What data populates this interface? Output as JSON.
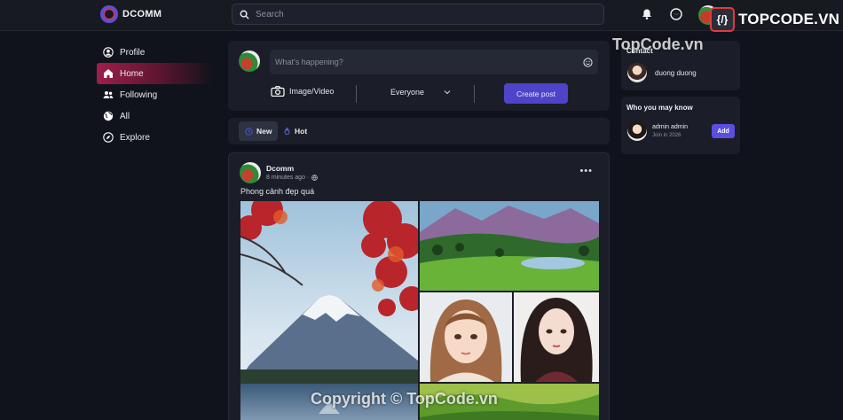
{
  "app": {
    "name": "DCOMM"
  },
  "search": {
    "placeholder": "Search"
  },
  "brand_badge": {
    "mark": "{/}",
    "text": "TOPCODE.VN"
  },
  "nav": {
    "items": [
      {
        "label": "Profile",
        "icon": "user-circle-icon"
      },
      {
        "label": "Home",
        "icon": "home-icon",
        "active": true
      },
      {
        "label": "Following",
        "icon": "users-icon"
      },
      {
        "label": "All",
        "icon": "globe-icon"
      },
      {
        "label": "Explore",
        "icon": "compass-icon"
      }
    ]
  },
  "composer": {
    "placeholder": "What's happening?",
    "media_label": "Image/Video",
    "audience": "Everyone",
    "create_label": "Create post"
  },
  "feed_tabs": [
    {
      "label": "New",
      "selected": true
    },
    {
      "label": "Hot",
      "selected": false
    }
  ],
  "post": {
    "author": "Dcomm",
    "time": "8 minutes ago ·",
    "text": "Phong cảnh đẹp quá"
  },
  "contact": {
    "title": "Contact",
    "items": [
      {
        "name": "duong duong"
      }
    ]
  },
  "suggest": {
    "title": "Who you may know",
    "items": [
      {
        "name": "admin admin",
        "sub": "Join in 2026",
        "action": "Add"
      }
    ]
  },
  "watermarks": {
    "top": "TopCode.vn",
    "bottom": "Copyright © TopCode.vn"
  },
  "colors": {
    "accent": "#4e43c9",
    "active_nav": "#9d1e4a",
    "background": "#11131c",
    "card": "#1b1e28"
  }
}
